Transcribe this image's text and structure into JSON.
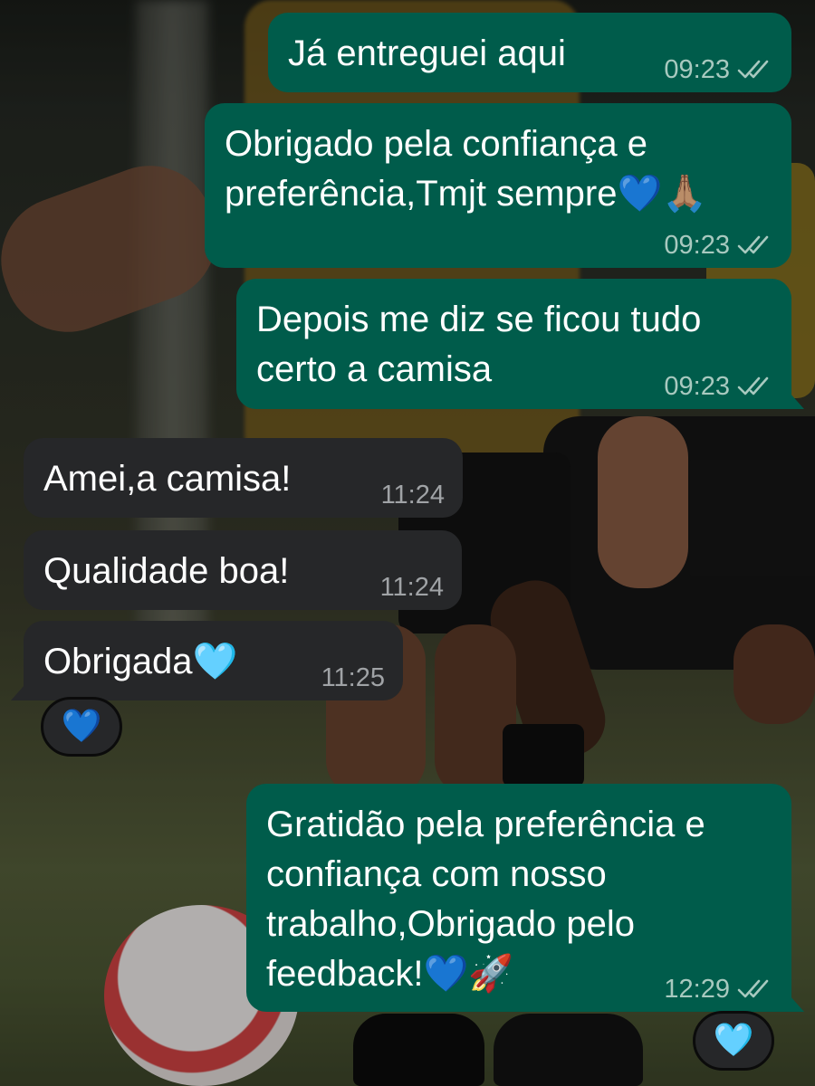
{
  "messages": [
    {
      "direction": "outgoing",
      "text": "Já entreguei aqui",
      "time": "09:23",
      "status": "read"
    },
    {
      "direction": "outgoing",
      "text": "Obrigado pela confiança e\npreferência,Tmjt sempre💙🙏🏽",
      "time": "09:23",
      "status": "read"
    },
    {
      "direction": "outgoing",
      "text": "Depois me diz se ficou tudo\ncerto a camisa",
      "time": "09:23",
      "status": "read"
    },
    {
      "direction": "incoming",
      "text": "Amei,a camisa!",
      "time": "11:24"
    },
    {
      "direction": "incoming",
      "text": "Qualidade boa!",
      "time": "11:24"
    },
    {
      "direction": "incoming",
      "text": "Obrigada🩵",
      "time": "11:25",
      "reaction": "💙"
    },
    {
      "direction": "outgoing",
      "text": "Gratidão pela preferência e\nconfiança com nosso\ntrabalho,Obrigado pelo\nfeedback!💙🚀",
      "time": "12:29",
      "status": "read",
      "reaction": "🩵"
    }
  ],
  "colors": {
    "outgoing_bubble": "#005c4b",
    "incoming_bubble": "#262729",
    "read_ticks": "#a8c9bf",
    "text": "#ffffff"
  },
  "icons": {
    "read_receipt": "double-check-icon"
  }
}
